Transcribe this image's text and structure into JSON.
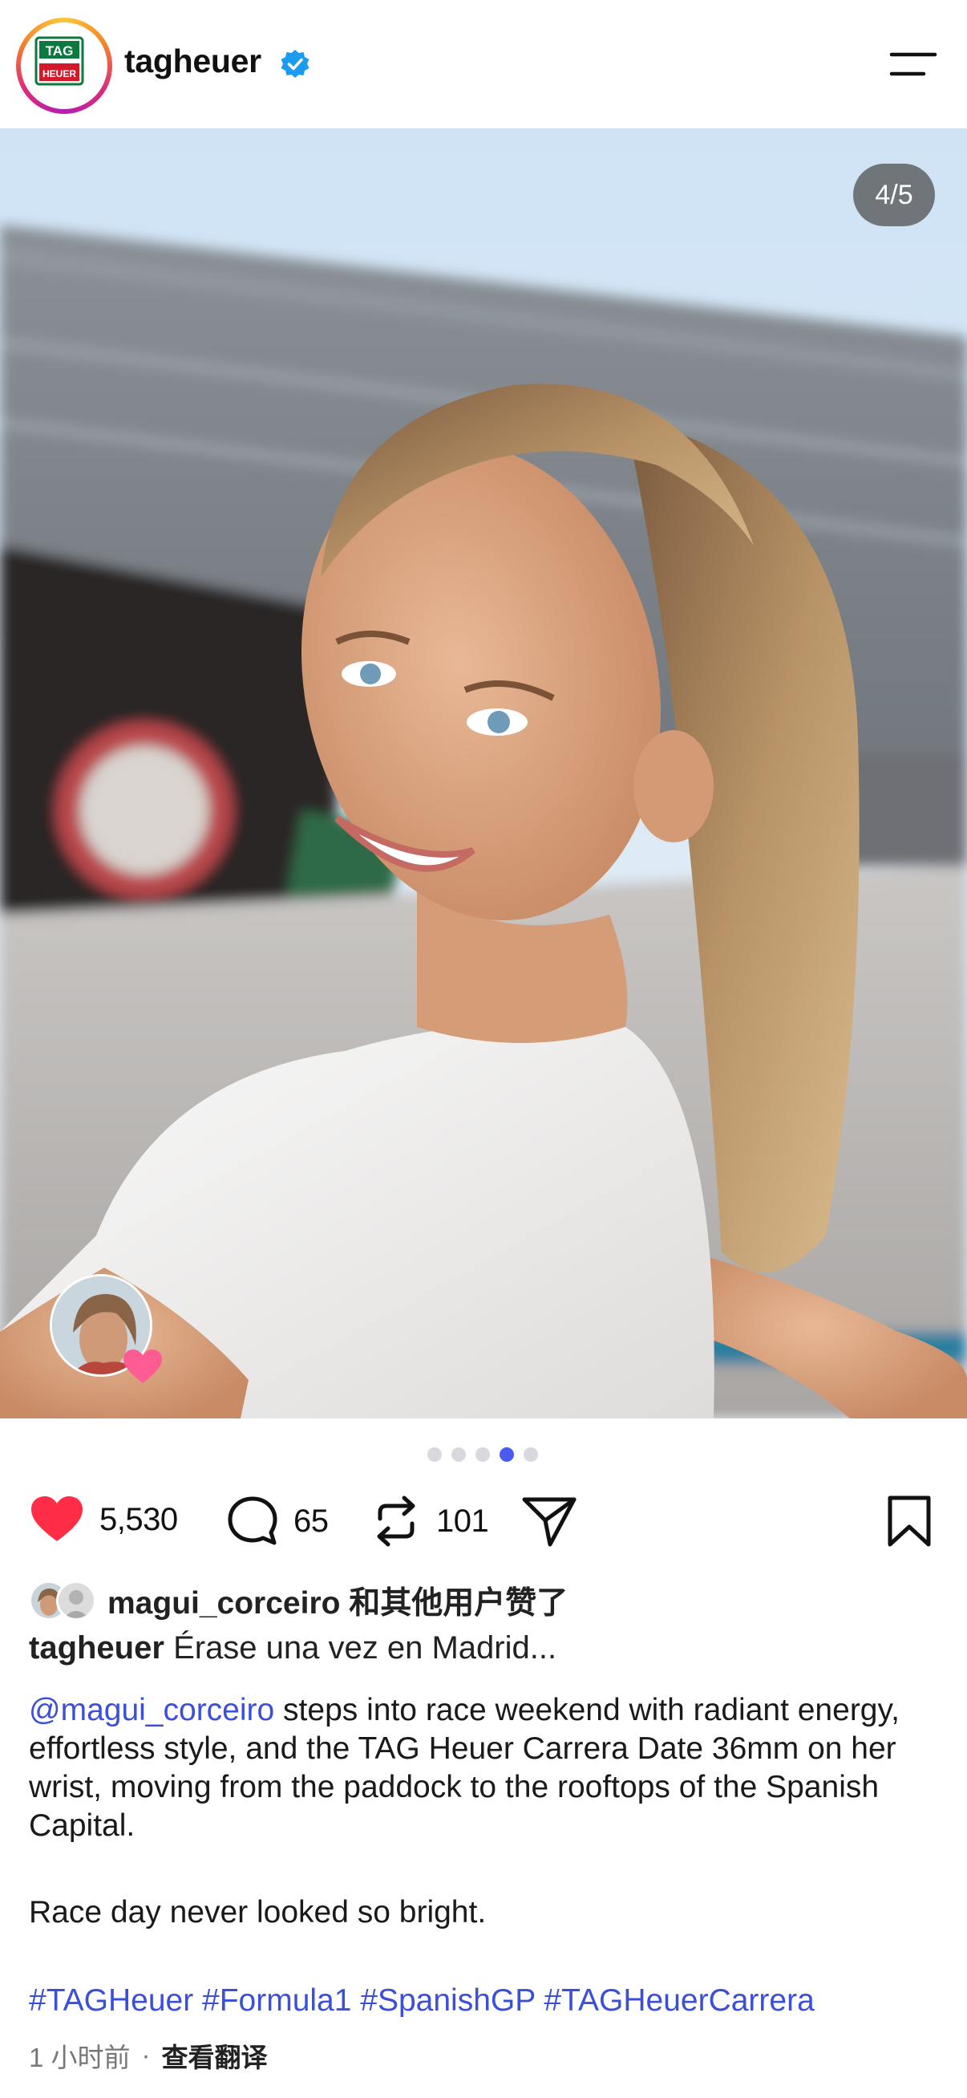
{
  "header": {
    "username": "tagheuer",
    "logo_text_top": "TAG",
    "logo_text_bottom": "HEUER"
  },
  "media": {
    "counter": "4/5",
    "current_index": 4,
    "total": 5
  },
  "actions": {
    "likes": "5,530",
    "comments": "65",
    "reposts": "101"
  },
  "likes_line": {
    "text": "magui_corceiro 和其他用户赞了"
  },
  "caption": {
    "username": "tagheuer",
    "title": "Érase una vez en Madrid...",
    "mention": "@magui_corceiro",
    "body": " steps into race weekend with radiant energy, effortless style, and the TAG Heuer Carrera Date 36mm on her wrist, moving from the paddock to the rooftops of the Spanish Capital.",
    "line2": "Race day never looked so bright.",
    "hashtags": "#TAGHeuer #Formula1 #SpanishGP #TAGHeuerCarrera"
  },
  "meta": {
    "time": "1 小时前",
    "separator": "·",
    "translate": "查看翻译"
  },
  "colors": {
    "like_red": "#ff2d45",
    "link_blue": "#3b4fd8",
    "active_dot": "#4a5cf0"
  }
}
